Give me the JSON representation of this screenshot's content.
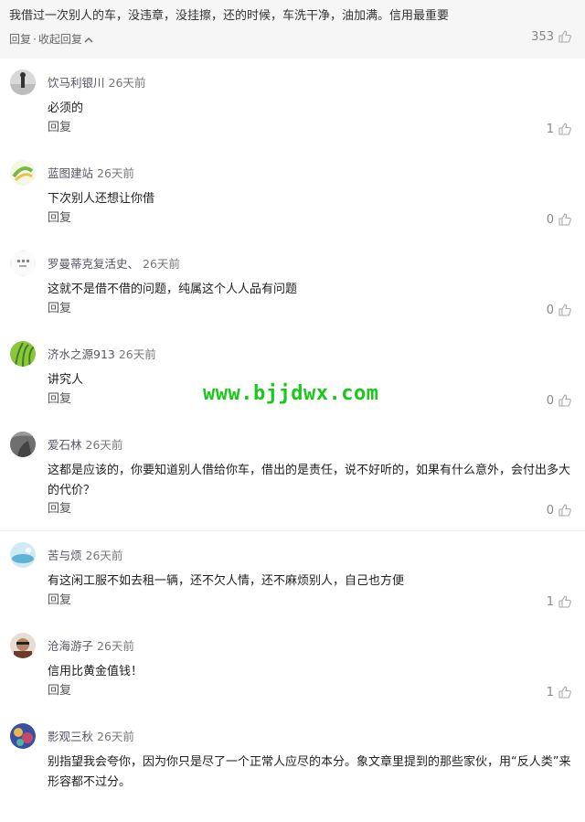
{
  "top": {
    "text": "我借过一次别人的车，没违章，没挂擦，还的时候，车洗干净，油加满。信用最重要",
    "reply_label": "回复",
    "collapse_label": "收起回复",
    "likes": "353"
  },
  "replies": [
    {
      "name": "饮马利银川",
      "date": "26天前",
      "text": "必须的",
      "reply_label": "回复",
      "likes": "1"
    },
    {
      "name": "蓝图建站",
      "date": "26天前",
      "text": "下次别人还想让你借",
      "reply_label": "回复",
      "likes": "0"
    },
    {
      "name": "罗曼蒂克复活史、",
      "date": "26天前",
      "text": "这就不是借不借的问题，纯属这个人人品有问题",
      "reply_label": "回复",
      "likes": "0"
    },
    {
      "name": "济水之源913",
      "date": "26天前",
      "text": "讲究人",
      "reply_label": "回复",
      "likes": "0"
    },
    {
      "name": "爱石林",
      "date": "26天前",
      "text": "这都是应该的，你要知道别人借给你车，借出的是责任，说不好听的，如果有什么意外，会付出多大的代价？",
      "reply_label": "回复",
      "likes": "0"
    },
    {
      "name": "苦与烦",
      "date": "26天前",
      "text": "有这闲工服不如去租一辆，还不欠人情，还不麻烦别人，自己也方便",
      "reply_label": "回复",
      "likes": "1"
    },
    {
      "name": "沧海游子",
      "date": "26天前",
      "text": "信用比黄金值钱！",
      "reply_label": "回复",
      "likes": "1"
    },
    {
      "name": "影观三秋",
      "date": "26天前",
      "text": "别指望我会夸你，因为你只是尽了一个正常人应尽的本分。象文章里提到的那些家伙，用“反人类”来形容都不过分。",
      "reply_label": "回复",
      "likes": ""
    }
  ],
  "watermark": "www.bjjdwx.com",
  "icons": {
    "like": "thumbs-up-icon",
    "collapse": "chevron-up-icon"
  },
  "colors": {
    "watermark": "#19c819",
    "top_bg": "#f6f6f6"
  }
}
